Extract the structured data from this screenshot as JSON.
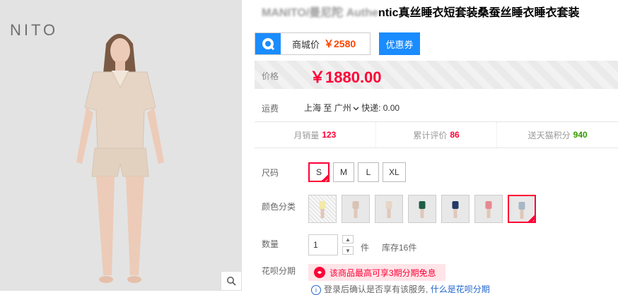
{
  "image": {
    "brand": "NITO"
  },
  "product": {
    "title_blurred": "MANITO/曼尼陀 Authe",
    "title": "ntic真丝睡衣短套装桑蚕丝睡衣睡衣套装"
  },
  "mall_price": {
    "label": "商城价",
    "value": "￥2580"
  },
  "coupon": {
    "label": "优惠券"
  },
  "price": {
    "label": "价格",
    "value": "￥1880.00"
  },
  "shipping": {
    "label": "运费",
    "from": "上海",
    "to_word": "至",
    "to": "广州",
    "method": "快递: 0.00"
  },
  "stats": {
    "sales": {
      "label": "月销量",
      "value": "123"
    },
    "reviews": {
      "label": "累计评价",
      "value": "86"
    },
    "points": {
      "label": "送天猫积分",
      "value": "940"
    }
  },
  "size": {
    "label": "尺码",
    "options": [
      "S",
      "M",
      "L",
      "XL"
    ],
    "selected": "S"
  },
  "color": {
    "label": "颜色分类",
    "swatches": [
      {
        "name": "pattern",
        "hex": "#f7f7f7"
      },
      {
        "name": "champagne",
        "hex": "#d9c3b4"
      },
      {
        "name": "nude",
        "hex": "#e7d5c7"
      },
      {
        "name": "green",
        "hex": "#1f5f46"
      },
      {
        "name": "navy",
        "hex": "#223a66"
      },
      {
        "name": "pink",
        "hex": "#e5898f"
      },
      {
        "name": "grey-blue",
        "hex": "#a8b7c6"
      }
    ],
    "selected_index": 6
  },
  "quantity": {
    "label": "数量",
    "value": "1",
    "unit": "件",
    "stock": "库存16件"
  },
  "huabei": {
    "label": "花呗分期",
    "banner": "该商品最高可享3期分期免息",
    "notice_prefix": "登录后确认是否享有该服务,",
    "notice_link": "什么是花呗分期"
  },
  "colors": {
    "accent_red": "#ff0036",
    "mall_orange": "#ff4400",
    "blue": "#1a8cff",
    "green": "#339900"
  }
}
